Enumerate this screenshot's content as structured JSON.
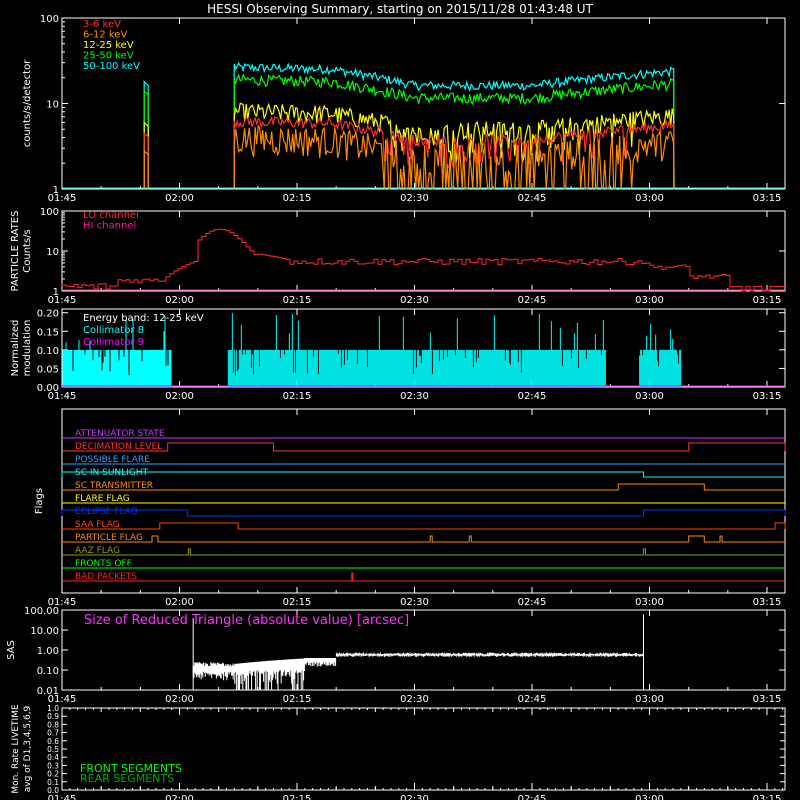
{
  "title": "HESSI Observing Summary, starting on 2015/11/28 01:43:48 UT",
  "time_ticks": [
    "01:45",
    "02:00",
    "02:15",
    "02:30",
    "02:45",
    "03:00",
    "03:15"
  ],
  "colors": {
    "bg": "#000000",
    "axis": "#ffffff",
    "e3_6": "#ff3030",
    "e6_12": "#ff8c00",
    "e12_25": "#ffff00",
    "e25_50": "#00ff00",
    "e50_100": "#00ffff",
    "lo": "#ff2a2a",
    "hi": "#ff1493",
    "coll8": "#00ffff",
    "coll9": "#ff00ff"
  },
  "panels": {
    "counts": {
      "ylabel": "counts/s/detector",
      "yticks": [
        "1",
        "10",
        "100"
      ],
      "legend": [
        {
          "label": "3-6 keV",
          "color": "#ff3030"
        },
        {
          "label": "6-12 keV",
          "color": "#ff8c00"
        },
        {
          "label": "12-25 keV",
          "color": "#ffff00"
        },
        {
          "label": "25-50 keV",
          "color": "#00ff00"
        },
        {
          "label": "50-100 keV",
          "color": "#00ffff"
        }
      ]
    },
    "particle": {
      "ylabel1": "PARTICLE RATES",
      "ylabel2": "Counts/s",
      "yticks": [
        "1",
        "10",
        "100"
      ],
      "legend": [
        {
          "label": "LO channel",
          "color": "#ff2a2a"
        },
        {
          "label": "HI channel",
          "color": "#ff1493"
        }
      ]
    },
    "modulation": {
      "ylabel1": "Normalized",
      "ylabel2": "modulation",
      "yticks": [
        "0.00",
        "0.05",
        "0.10",
        "0.15",
        "0.20"
      ],
      "legend": [
        {
          "label": "Energy band: 12-25 keV",
          "color": "#ffffff"
        },
        {
          "label": "Collimator 8",
          "color": "#00ffff"
        },
        {
          "label": "Collimator 9",
          "color": "#ff00ff"
        }
      ]
    },
    "flags": {
      "ylabel": "Flags",
      "items": [
        {
          "label": "ATTENUATOR STATE",
          "color": "#cc33ff"
        },
        {
          "label": "DECIMATION LEVEL",
          "color": "#ff3333"
        },
        {
          "label": "POSSIBLE FLARE",
          "color": "#3399ff"
        },
        {
          "label": "SC IN SUNLIGHT",
          "color": "#00ffff"
        },
        {
          "label": "SC TRANSMITTER",
          "color": "#ff8c00"
        },
        {
          "label": "FLARE FLAG",
          "color": "#ffff00"
        },
        {
          "label": "ECLIPSE FLAG",
          "color": "#0033ff"
        },
        {
          "label": "SAA FLAG",
          "color": "#ff4400"
        },
        {
          "label": "PARTICLE FLAG",
          "color": "#ff8800"
        },
        {
          "label": "AAZ FLAG",
          "color": "#999900"
        },
        {
          "label": "FRONTS OFF",
          "color": "#00ff00"
        },
        {
          "label": "BAD PACKETS",
          "color": "#ff2222"
        }
      ]
    },
    "sas": {
      "ylabel": "SAS",
      "yticks": [
        "0.01",
        "0.10",
        "1.00",
        "10.00",
        "100.00"
      ],
      "annotation": "Size of Reduced Triangle (absolute value) [arcsec]"
    },
    "livetime": {
      "ylabel1": "Mon. Rate LIVETIME",
      "ylabel2": "avg of D1,3,4,5,6,9",
      "yticks": [
        "0.0",
        "0.1",
        "0.2",
        "0.3",
        "0.4",
        "0.5",
        "0.6",
        "0.7",
        "0.8",
        "0.9",
        "1.0"
      ],
      "legend": [
        {
          "label": "FRONT SEGMENTS",
          "color": "#00ff00"
        },
        {
          "label": "REAR SEGMENTS",
          "color": "#00aa00"
        }
      ]
    }
  },
  "chart_data": [
    {
      "type": "line",
      "title": "HESSI Observing Summary, starting on 2015/11/28 01:43:48 UT",
      "ylabel": "counts/s/detector",
      "yscale": "log",
      "ylim": [
        1,
        100
      ],
      "xlim": [
        "01:43:48",
        "03:25"
      ],
      "series": [
        {
          "name": "3-6 keV",
          "x": [
            "01:56",
            "02:07",
            "02:15",
            "02:30",
            "02:45",
            "03:00"
          ],
          "values": [
            5,
            6.5,
            6,
            4,
            4,
            5.5
          ]
        },
        {
          "name": "6-12 keV",
          "x": [
            "01:56",
            "02:07",
            "02:15",
            "02:30",
            "02:45",
            "03:00"
          ],
          "values": [
            3,
            4,
            4,
            2,
            2,
            4
          ]
        },
        {
          "name": "12-25 keV",
          "x": [
            "01:56",
            "02:07",
            "02:15",
            "02:30",
            "02:45",
            "03:00"
          ],
          "values": [
            6,
            8,
            7,
            3.5,
            4,
            7
          ]
        },
        {
          "name": "25-50 keV",
          "x": [
            "01:56",
            "02:07",
            "02:15",
            "02:30",
            "02:45",
            "03:00"
          ],
          "values": [
            13,
            20,
            18,
            8,
            10,
            18
          ]
        },
        {
          "name": "50-100 keV",
          "x": [
            "01:56",
            "02:07",
            "02:15",
            "02:30",
            "02:45",
            "03:00"
          ],
          "values": [
            18,
            28,
            26,
            11,
            14,
            26
          ]
        }
      ]
    },
    {
      "type": "line",
      "ylabel": "PARTICLE RATES Counts/s",
      "yscale": "log",
      "ylim": [
        1,
        100
      ],
      "series": [
        {
          "name": "LO channel",
          "x": [
            "01:45",
            "01:55",
            "01:58",
            "02:02",
            "02:04",
            "02:07",
            "02:15",
            "02:30",
            "02:45",
            "03:00",
            "03:07",
            "03:10"
          ],
          "values": [
            1.3,
            1.5,
            2,
            25,
            35,
            10,
            6,
            5,
            6,
            5,
            2,
            1.3
          ]
        },
        {
          "name": "HI channel",
          "x": [
            "01:45",
            "03:25"
          ],
          "values": [
            1,
            1
          ]
        }
      ]
    },
    {
      "type": "bar",
      "ylabel": "Normalized modulation",
      "ylim": [
        0,
        0.2
      ],
      "series": [
        {
          "name": "Collimator 8",
          "x": [
            "01:45",
            "02:00",
            "02:08",
            "02:45",
            "02:55",
            "03:00",
            "03:04"
          ],
          "values": [
            0.1,
            0.1,
            0.1,
            0.1,
            0.1,
            0.1,
            0.0
          ]
        },
        {
          "name": "Collimator 9",
          "x": [
            "01:45",
            "03:25"
          ],
          "values": [
            0,
            0
          ]
        }
      ]
    },
    {
      "type": "line",
      "ylabel": "SAS",
      "yscale": "log",
      "ylim": [
        0.01,
        100
      ],
      "series": [
        {
          "name": "Size of Reduced Triangle (absolute value) [arcsec]",
          "x": [
            "02:01",
            "02:05",
            "02:10",
            "02:15",
            "02:20",
            "02:30",
            "02:45",
            "02:59"
          ],
          "values": [
            0.1,
            0.08,
            0.12,
            0.3,
            0.5,
            0.6,
            0.6,
            0.6
          ]
        }
      ]
    }
  ]
}
